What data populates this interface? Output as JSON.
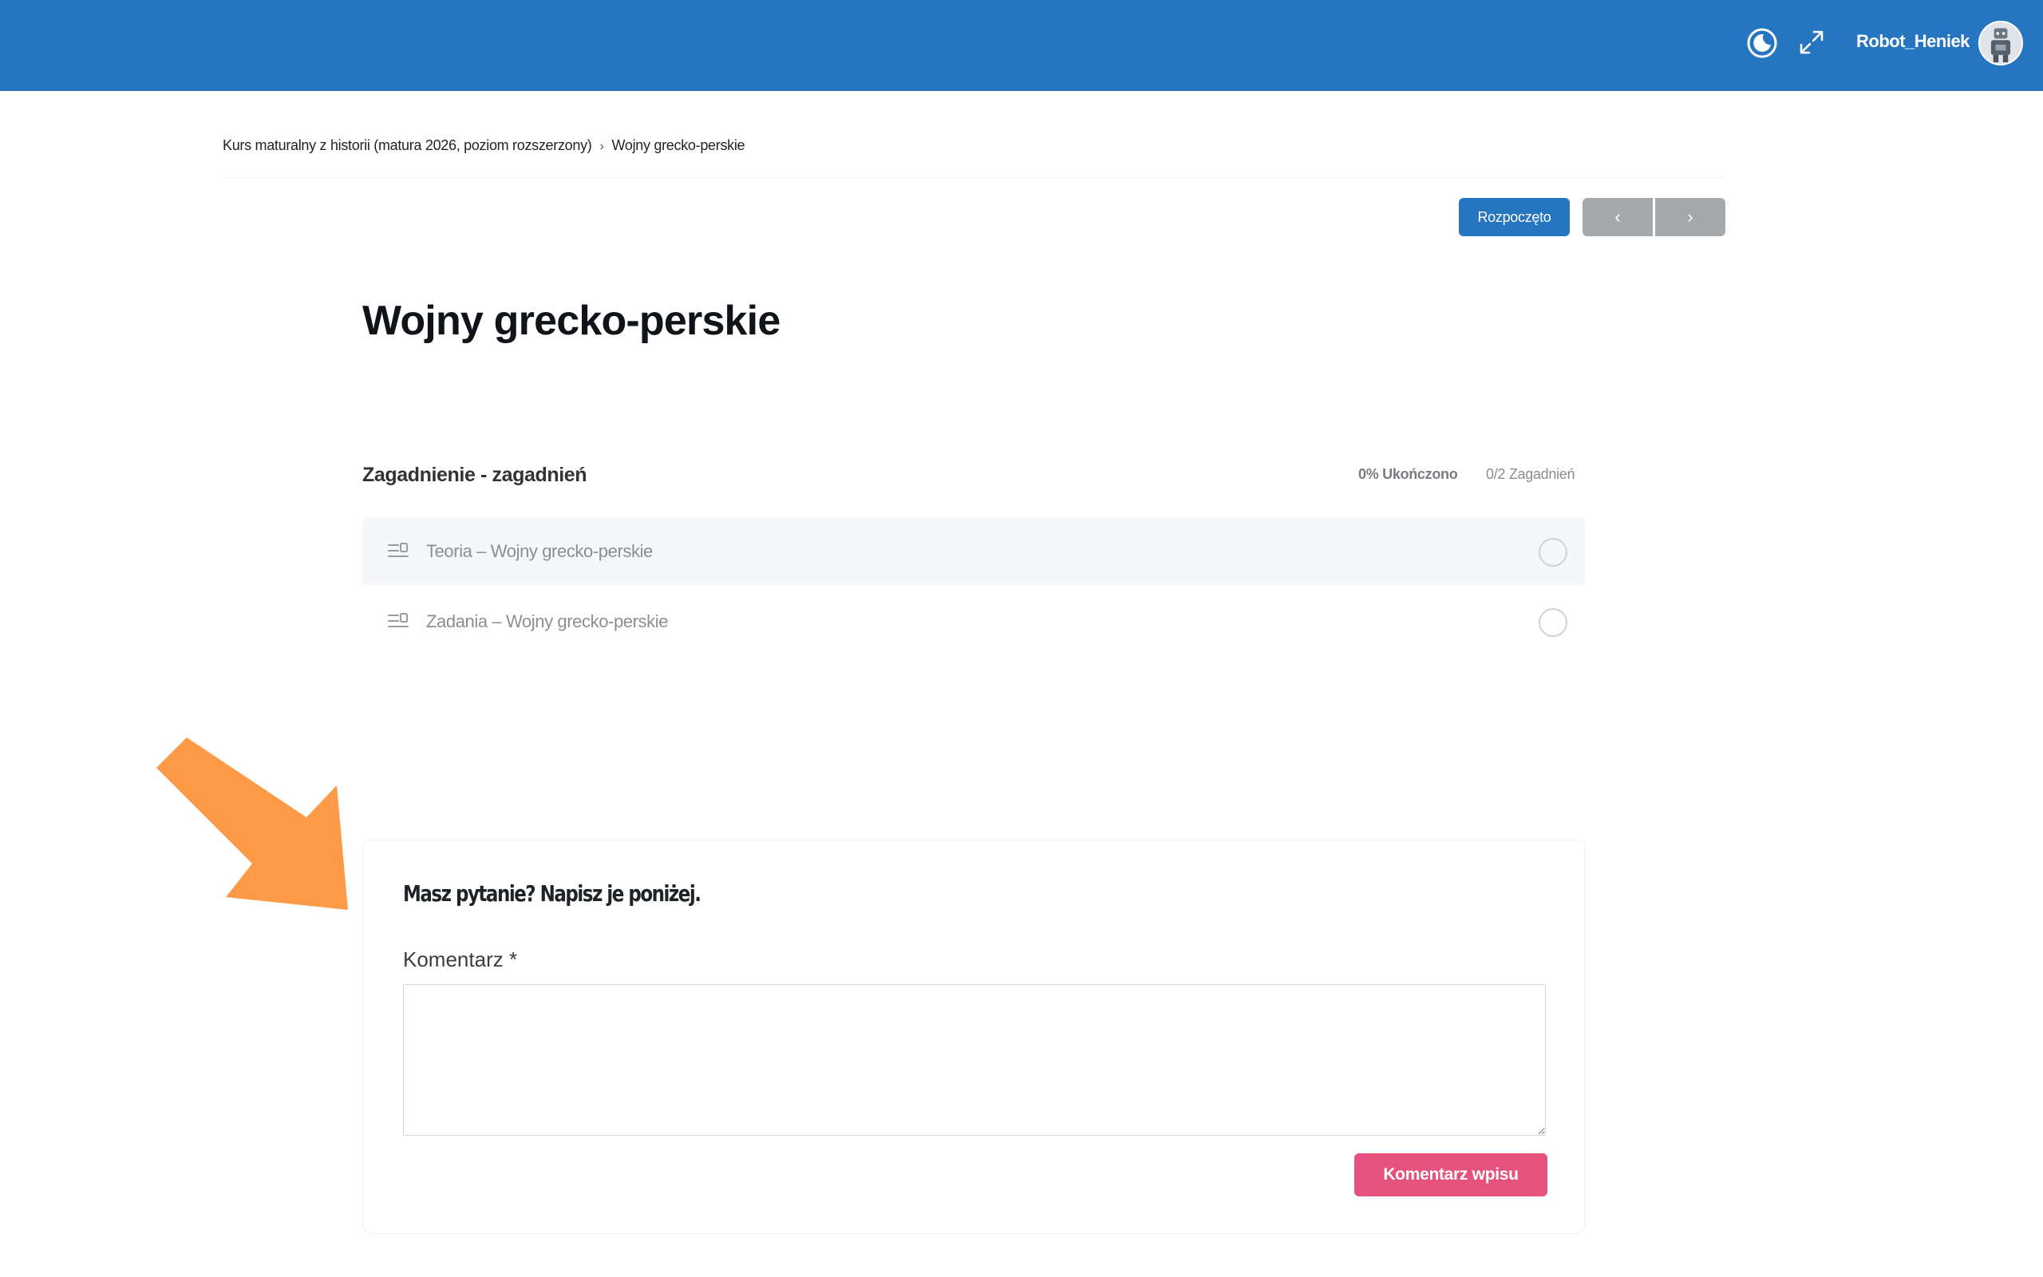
{
  "header": {
    "username": "Robot_Heniek",
    "icons": [
      "moon-icon",
      "expand-icon"
    ],
    "background_color": "#2675c1"
  },
  "breadcrumb": {
    "items": [
      "Kurs maturalny z historii (matura 2026, poziom rozszerzony)",
      "Wojny grecko-perskie"
    ]
  },
  "status": {
    "label": "Rozpoczęto",
    "prev_label": "‹",
    "next_label": "›"
  },
  "lesson": {
    "title": "Wojny grecko-perskie"
  },
  "topics": {
    "heading": "Zagadnienie - zagadnień",
    "progress": "0% Ukończono",
    "count": "0/2 Zagadnień",
    "items": [
      {
        "label": "Teoria – Wojny grecko-perskie"
      },
      {
        "label": "Zadania – Wojny grecko-perskie"
      }
    ]
  },
  "comment_form": {
    "title": "Masz pytanie? Napisz je poniżej.",
    "field_label": "Komentarz *",
    "field_value": "",
    "submit_label": "Komentarz wpisu"
  },
  "colors": {
    "accent": "#2675c1",
    "submit": "#e5527e",
    "arrow": "#fd9a47",
    "nav_button": "#a6a9ab"
  }
}
